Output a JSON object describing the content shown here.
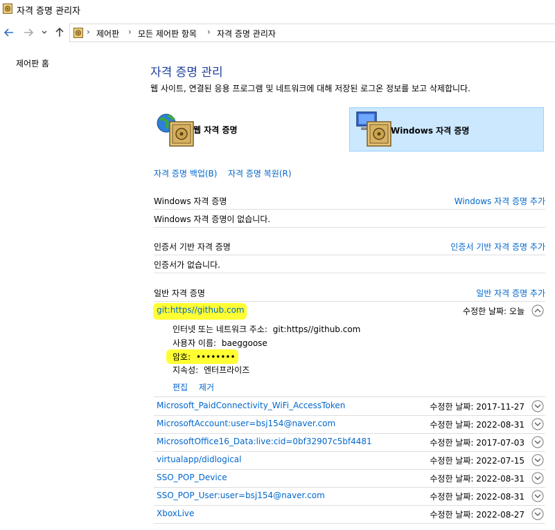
{
  "window": {
    "title": "자격 증명 관리자"
  },
  "breadcrumb": [
    "제어판",
    "모든 제어판 항목",
    "자격 증명 관리자"
  ],
  "sidebar": {
    "home_link": "제어판 홈"
  },
  "main": {
    "title": "자격 증명 관리",
    "description": "웹 사이트, 연결된 응용 프로그램 및 네트워크에 대해 저장된 로그온 정보를 보고 삭제합니다.",
    "categories": {
      "web": "웹 자격 증명",
      "windows": "Windows 자격 증명"
    },
    "backup_link": "자격 증명 백업(B)",
    "restore_link": "자격 증명 복원(R)"
  },
  "sections": {
    "windows": {
      "title": "Windows 자격 증명",
      "add": "Windows 자격 증명 추가",
      "empty": "Windows 자격 증명이 없습니다."
    },
    "certificate": {
      "title": "인증서 기반 자격 증명",
      "add": "인증서 기반 자격 증명 추가",
      "empty": "인증서가 없습니다."
    },
    "generic": {
      "title": "일반 자격 증명",
      "add": "일반 자격 증명 추가"
    }
  },
  "expanded": {
    "name": "git:https//github.com",
    "modified": "수정한 날짜:  오늘",
    "address_label": "인터넷 또는 네트워크 주소:",
    "address_value": "git:https//github.com",
    "user_label": "사용자 이름:",
    "user_value": "baeggoose",
    "password_label": "암호:",
    "password_value": "••••••••",
    "persistence_label": "지속성:",
    "persistence_value": "엔터프라이즈",
    "edit": "편집",
    "remove": "제거"
  },
  "credentials": [
    {
      "name": "Microsoft_PaidConnectivity_WiFi_AccessToken",
      "modified": "수정한 날짜:  2017-11-27"
    },
    {
      "name": "MicrosoftAccount:user=bsj154@naver.com",
      "modified": "수정한 날짜:  2022-08-31"
    },
    {
      "name": "MicrosoftOffice16_Data:live:cid=0bf32907c5bf4481",
      "modified": "수정한 날짜:  2017-07-03"
    },
    {
      "name": "virtualapp/didlogical",
      "modified": "수정한 날짜:  2022-07-15"
    },
    {
      "name": "SSO_POP_Device",
      "modified": "수정한 날짜:  2022-08-31"
    },
    {
      "name": "SSO_POP_User:user=bsj154@naver.com",
      "modified": "수정한 날짜:  2022-08-31"
    },
    {
      "name": "XboxLive",
      "modified": "수정한 날짜:  2022-08-27"
    }
  ],
  "colors": {
    "link": "#0066cc",
    "title": "#1e3f9b",
    "selected_tile": "#cce8ff",
    "highlight": "#ffff33"
  },
  "icons": [
    "vault-icon",
    "back-arrow-icon",
    "forward-arrow-icon",
    "chevron-down-icon",
    "up-arrow-icon",
    "globe-icon",
    "computer-icon",
    "chevron-up-circle-icon",
    "chevron-down-circle-icon"
  ]
}
